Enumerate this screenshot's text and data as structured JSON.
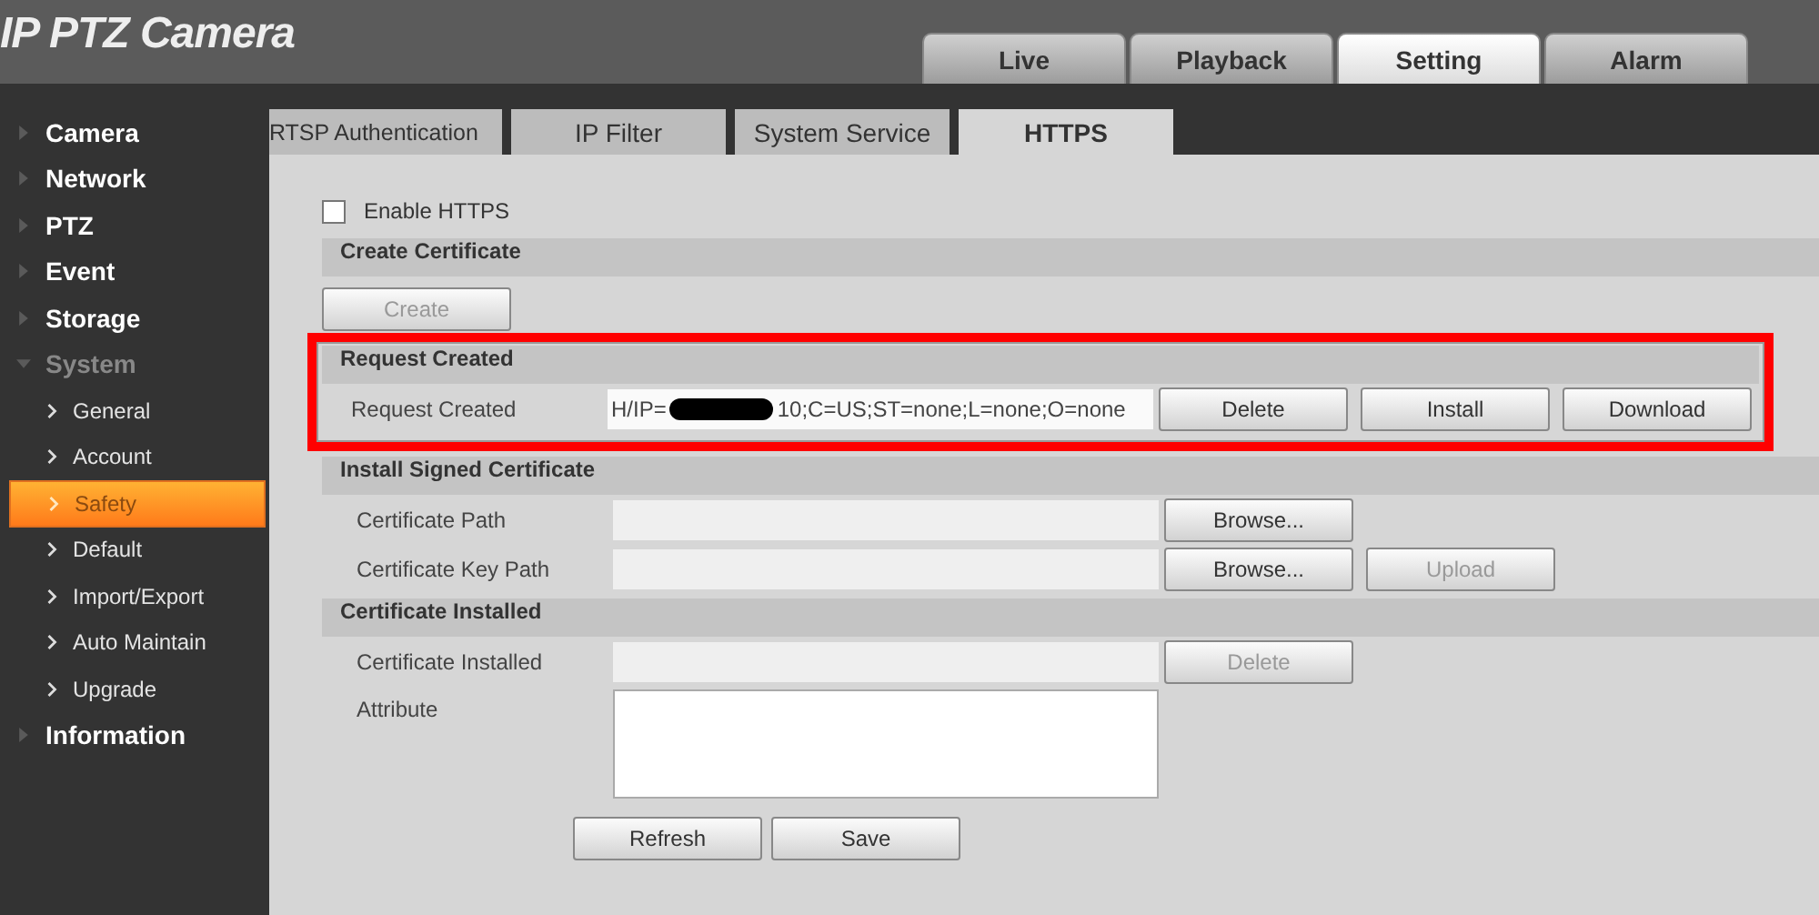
{
  "header": {
    "title": "IP PTZ Camera"
  },
  "main_tabs": [
    {
      "label": "Live",
      "selected": false
    },
    {
      "label": "Playback",
      "selected": false
    },
    {
      "label": "Setting",
      "selected": true
    },
    {
      "label": "Alarm",
      "selected": false
    }
  ],
  "sidebar": {
    "items": [
      {
        "label": "Camera",
        "expanded": false
      },
      {
        "label": "Network",
        "expanded": false
      },
      {
        "label": "PTZ",
        "expanded": false
      },
      {
        "label": "Event",
        "expanded": false
      },
      {
        "label": "Storage",
        "expanded": false
      },
      {
        "label": "System",
        "expanded": true,
        "children": [
          {
            "label": "General",
            "selected": false
          },
          {
            "label": "Account",
            "selected": false
          },
          {
            "label": "Safety",
            "selected": true
          },
          {
            "label": "Default",
            "selected": false
          },
          {
            "label": "Import/Export",
            "selected": false
          },
          {
            "label": "Auto Maintain",
            "selected": false
          },
          {
            "label": "Upgrade",
            "selected": false
          }
        ]
      },
      {
        "label": "Information",
        "expanded": false
      }
    ]
  },
  "sub_tabs": [
    {
      "label": "RTSP Authentication",
      "selected": false
    },
    {
      "label": "IP Filter",
      "selected": false
    },
    {
      "label": "System Service",
      "selected": false
    },
    {
      "label": "HTTPS",
      "selected": true
    }
  ],
  "enable_https": {
    "label": "Enable HTTPS",
    "checked": false
  },
  "sections": [
    {
      "title": "Create Certificate",
      "highlighted": false,
      "rows": [
        {
          "kind": "buttons",
          "buttons": [
            {
              "label": "Create",
              "disabled": true
            }
          ]
        }
      ]
    },
    {
      "title": "Request Created",
      "highlighted": true,
      "rows": [
        {
          "kind": "field",
          "label": "Request Created",
          "value_before": "H/IP=",
          "redacted": true,
          "value_after": "10;C=US;ST=none;L=none;O=none",
          "buttons": [
            {
              "label": "Delete",
              "disabled": false
            },
            {
              "label": "Install",
              "disabled": false
            },
            {
              "label": "Download",
              "disabled": false
            }
          ]
        }
      ]
    },
    {
      "title": "Install Signed Certificate",
      "highlighted": false,
      "rows": [
        {
          "kind": "field",
          "label": "Certificate Path",
          "buttons": [
            {
              "label": "Browse...",
              "disabled": false
            }
          ]
        },
        {
          "kind": "field",
          "label": "Certificate Key Path",
          "buttons": [
            {
              "label": "Browse...",
              "disabled": false
            },
            {
              "label": "Upload",
              "disabled": true
            }
          ]
        }
      ]
    },
    {
      "title": "Certificate Installed",
      "highlighted": false,
      "rows": [
        {
          "kind": "field",
          "label": "Certificate Installed",
          "buttons": [
            {
              "label": "Delete",
              "disabled": true
            }
          ]
        },
        {
          "kind": "textarea",
          "label": "Attribute"
        }
      ]
    }
  ],
  "footer_buttons": [
    {
      "label": "Refresh"
    },
    {
      "label": "Save"
    }
  ]
}
